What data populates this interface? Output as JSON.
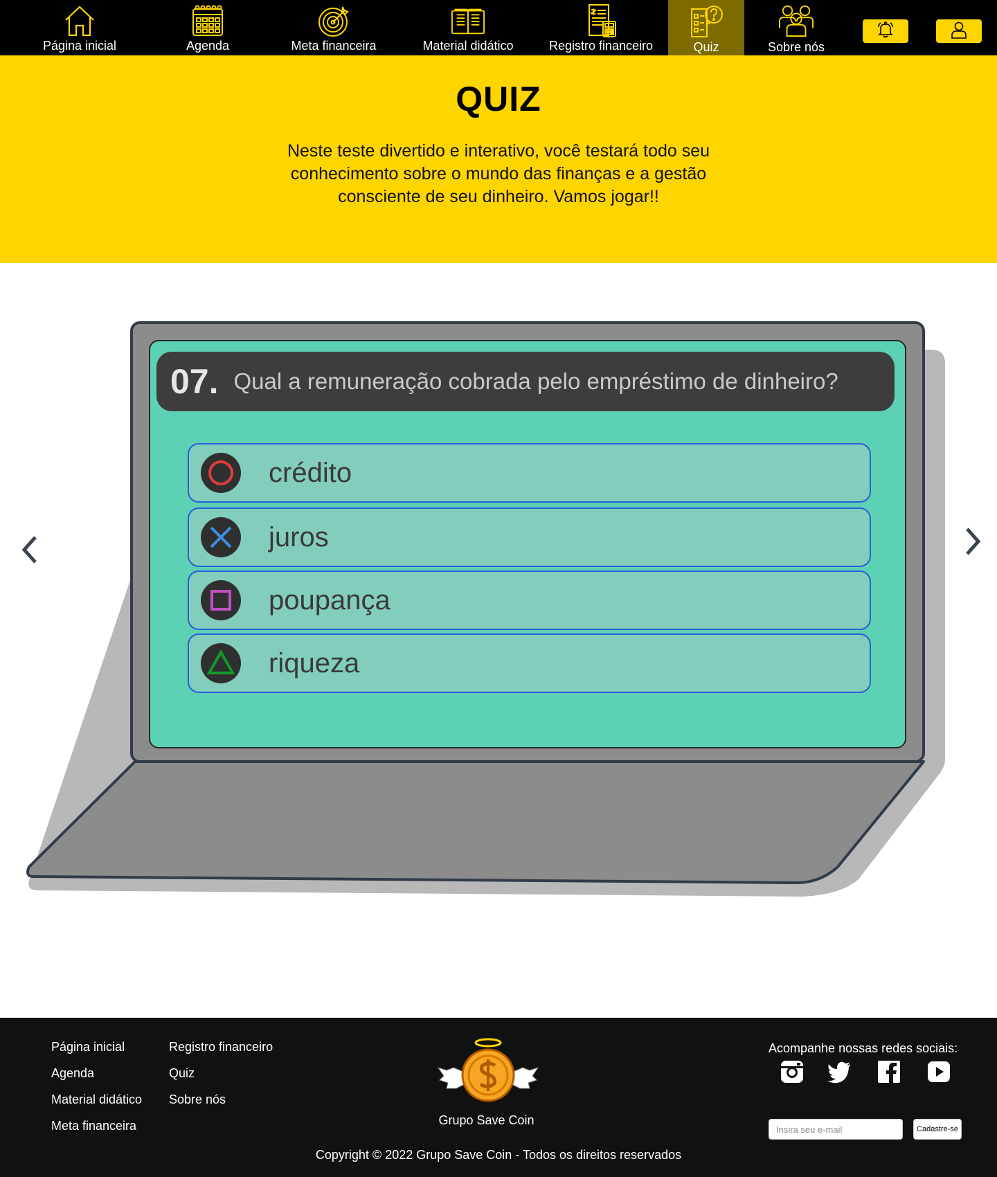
{
  "nav": {
    "items": [
      {
        "label": "Página inicial",
        "icon": "home-icon"
      },
      {
        "label": "Agenda",
        "icon": "calendar-icon"
      },
      {
        "label": "Meta financeira",
        "icon": "target-icon"
      },
      {
        "label": "Material didático",
        "icon": "book-icon"
      },
      {
        "label": "Registro financeiro",
        "icon": "ledger-icon"
      },
      {
        "label": "Quiz",
        "icon": "quiz-icon",
        "active": true
      },
      {
        "label": "Sobre nós",
        "icon": "team-icon"
      }
    ],
    "notification_icon": "bell-icon",
    "profile_icon": "user-icon",
    "accent_color": "#FFD500"
  },
  "hero": {
    "title": "QUIZ",
    "text": "Neste teste divertido e interativo, você testará todo seu conhecimento sobre o mundo das finanças e a gestão consciente de seu dinheiro. Vamos jogar!!"
  },
  "quiz": {
    "number": "07.",
    "question": "Qual a remuneração cobrada pelo empréstimo de dinheiro?",
    "options": [
      {
        "label": "crédito",
        "icon": "circle-icon",
        "color": "#e03c3c"
      },
      {
        "label": "juros",
        "icon": "cross-icon",
        "color": "#3c8fe0"
      },
      {
        "label": "poupança",
        "icon": "square-icon",
        "color": "#c050c0"
      },
      {
        "label": "riqueza",
        "icon": "triangle-icon",
        "color": "#119a2a"
      }
    ],
    "screen_color": "#5dd1b3"
  },
  "footer": {
    "links_col1": [
      "Página inicial",
      "Agenda",
      "Material didático",
      "Meta financeira"
    ],
    "links_col2": [
      "Registro financeiro",
      "Quiz",
      "Sobre nós"
    ],
    "brand": "Grupo Save Coin",
    "social_title": "Acompanhe nossas redes sociais:",
    "socials": [
      "instagram-icon",
      "twitter-icon",
      "facebook-icon",
      "youtube-icon"
    ],
    "email_placeholder": "Insira seu e-mail",
    "signup_label": "Cadastre-se",
    "copyright": "Copyright © 2022 Grupo Save Coin - Todos os direitos reservados"
  }
}
